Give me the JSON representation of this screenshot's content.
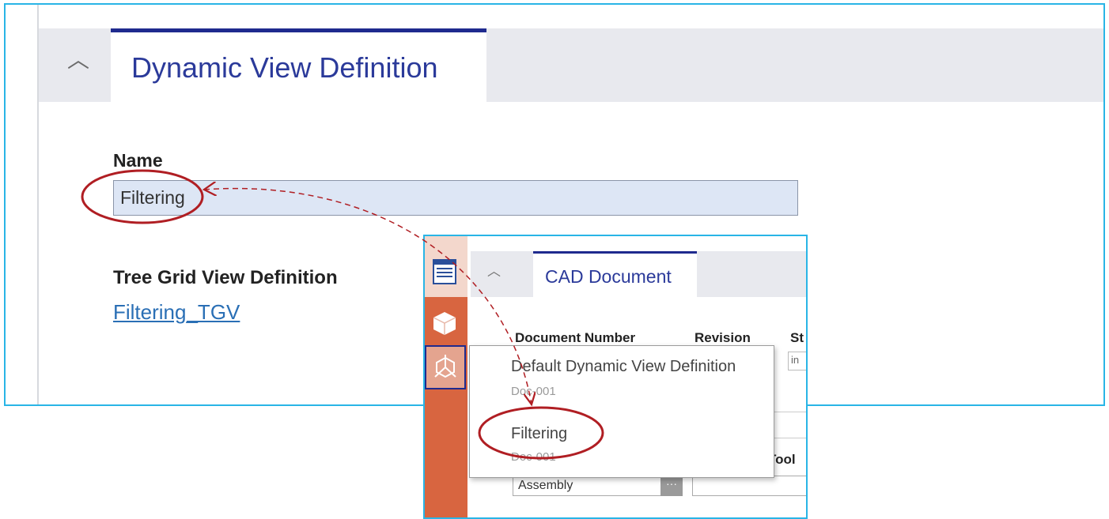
{
  "main": {
    "collapse_glyph": "︿",
    "tab_label": "Dynamic View Definition",
    "name_label": "Name",
    "name_value": "Filtering",
    "tree_grid_label": "Tree Grid View Definition",
    "tree_grid_link": "Filtering_TGV"
  },
  "popup": {
    "collapse_glyph": "︿",
    "tab_label": "CAD Document",
    "columns": {
      "document_number": "Document Number",
      "revision": "Revision",
      "status_partial": "St"
    },
    "status_value_partial": "in",
    "type_header_partial": "Tool",
    "type_value": "Assembly",
    "type_more_glyph": "···",
    "rail_icons": [
      "document-list-icon",
      "cube-icon",
      "structure-viewer-icon"
    ]
  },
  "dropdown": {
    "items": [
      {
        "title": "Default Dynamic View Definition",
        "subtitle": "Doc-001"
      },
      {
        "title": "Filtering",
        "subtitle": "Doc-001"
      }
    ]
  },
  "colors": {
    "frame_border": "#29b5e6",
    "tab_accent": "#1f2a8e",
    "tab_text": "#2b3a9a",
    "rail": "#d86540",
    "annotation_red": "#b01e23",
    "link": "#2a6fb5"
  }
}
